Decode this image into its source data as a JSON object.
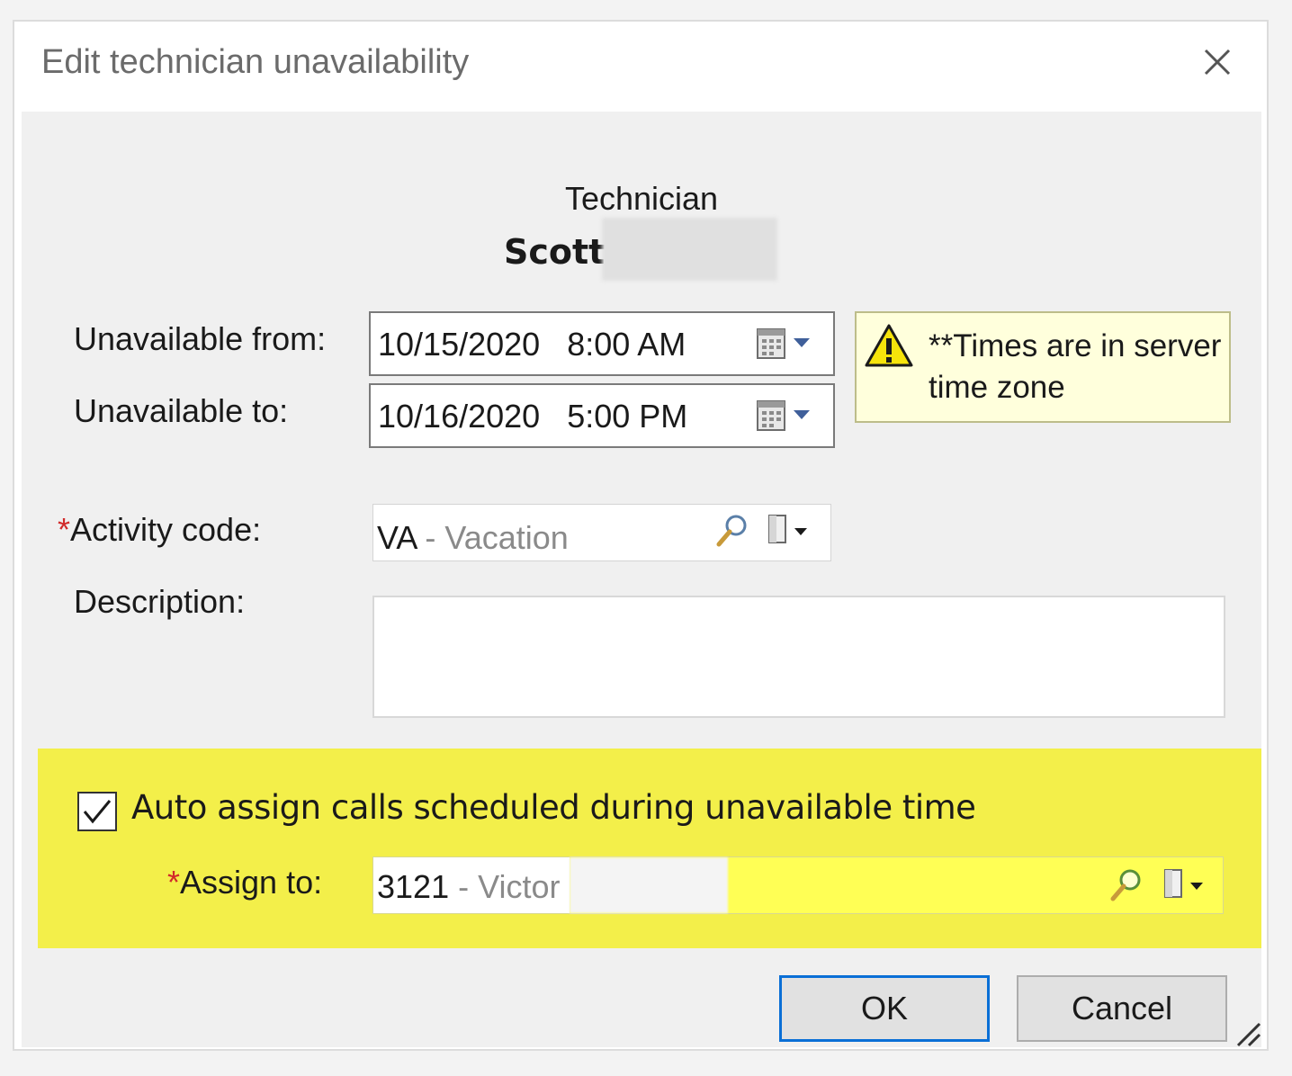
{
  "dialog": {
    "title": "Edit technician unavailability"
  },
  "technician": {
    "label": "Technician",
    "first_name": "Scott"
  },
  "fields": {
    "from_label": "Unavailable from:",
    "from_date": "10/15/2020",
    "from_time": "8:00 AM",
    "to_label": "Unavailable to:",
    "to_date": "10/16/2020",
    "to_time": "5:00 PM",
    "timezone_note": "**Times are in server time zone",
    "activity_label": "Activity code:",
    "activity_code": "VA",
    "activity_desc": "Vacation",
    "description_label": "Description:",
    "description_value": ""
  },
  "auto_assign": {
    "checked": true,
    "label": "Auto assign calls scheduled during unavailable time",
    "assign_label": "Assign to:",
    "assign_code": "3121",
    "assign_name": "Victor"
  },
  "buttons": {
    "ok": "OK",
    "cancel": "Cancel"
  },
  "colors": {
    "highlight": "#f3ef4a",
    "required": "#d12a2a",
    "ok_border": "#0a6fd6",
    "warning_bg": "#ffffdc"
  },
  "required_marker": "*",
  "separator": " - "
}
